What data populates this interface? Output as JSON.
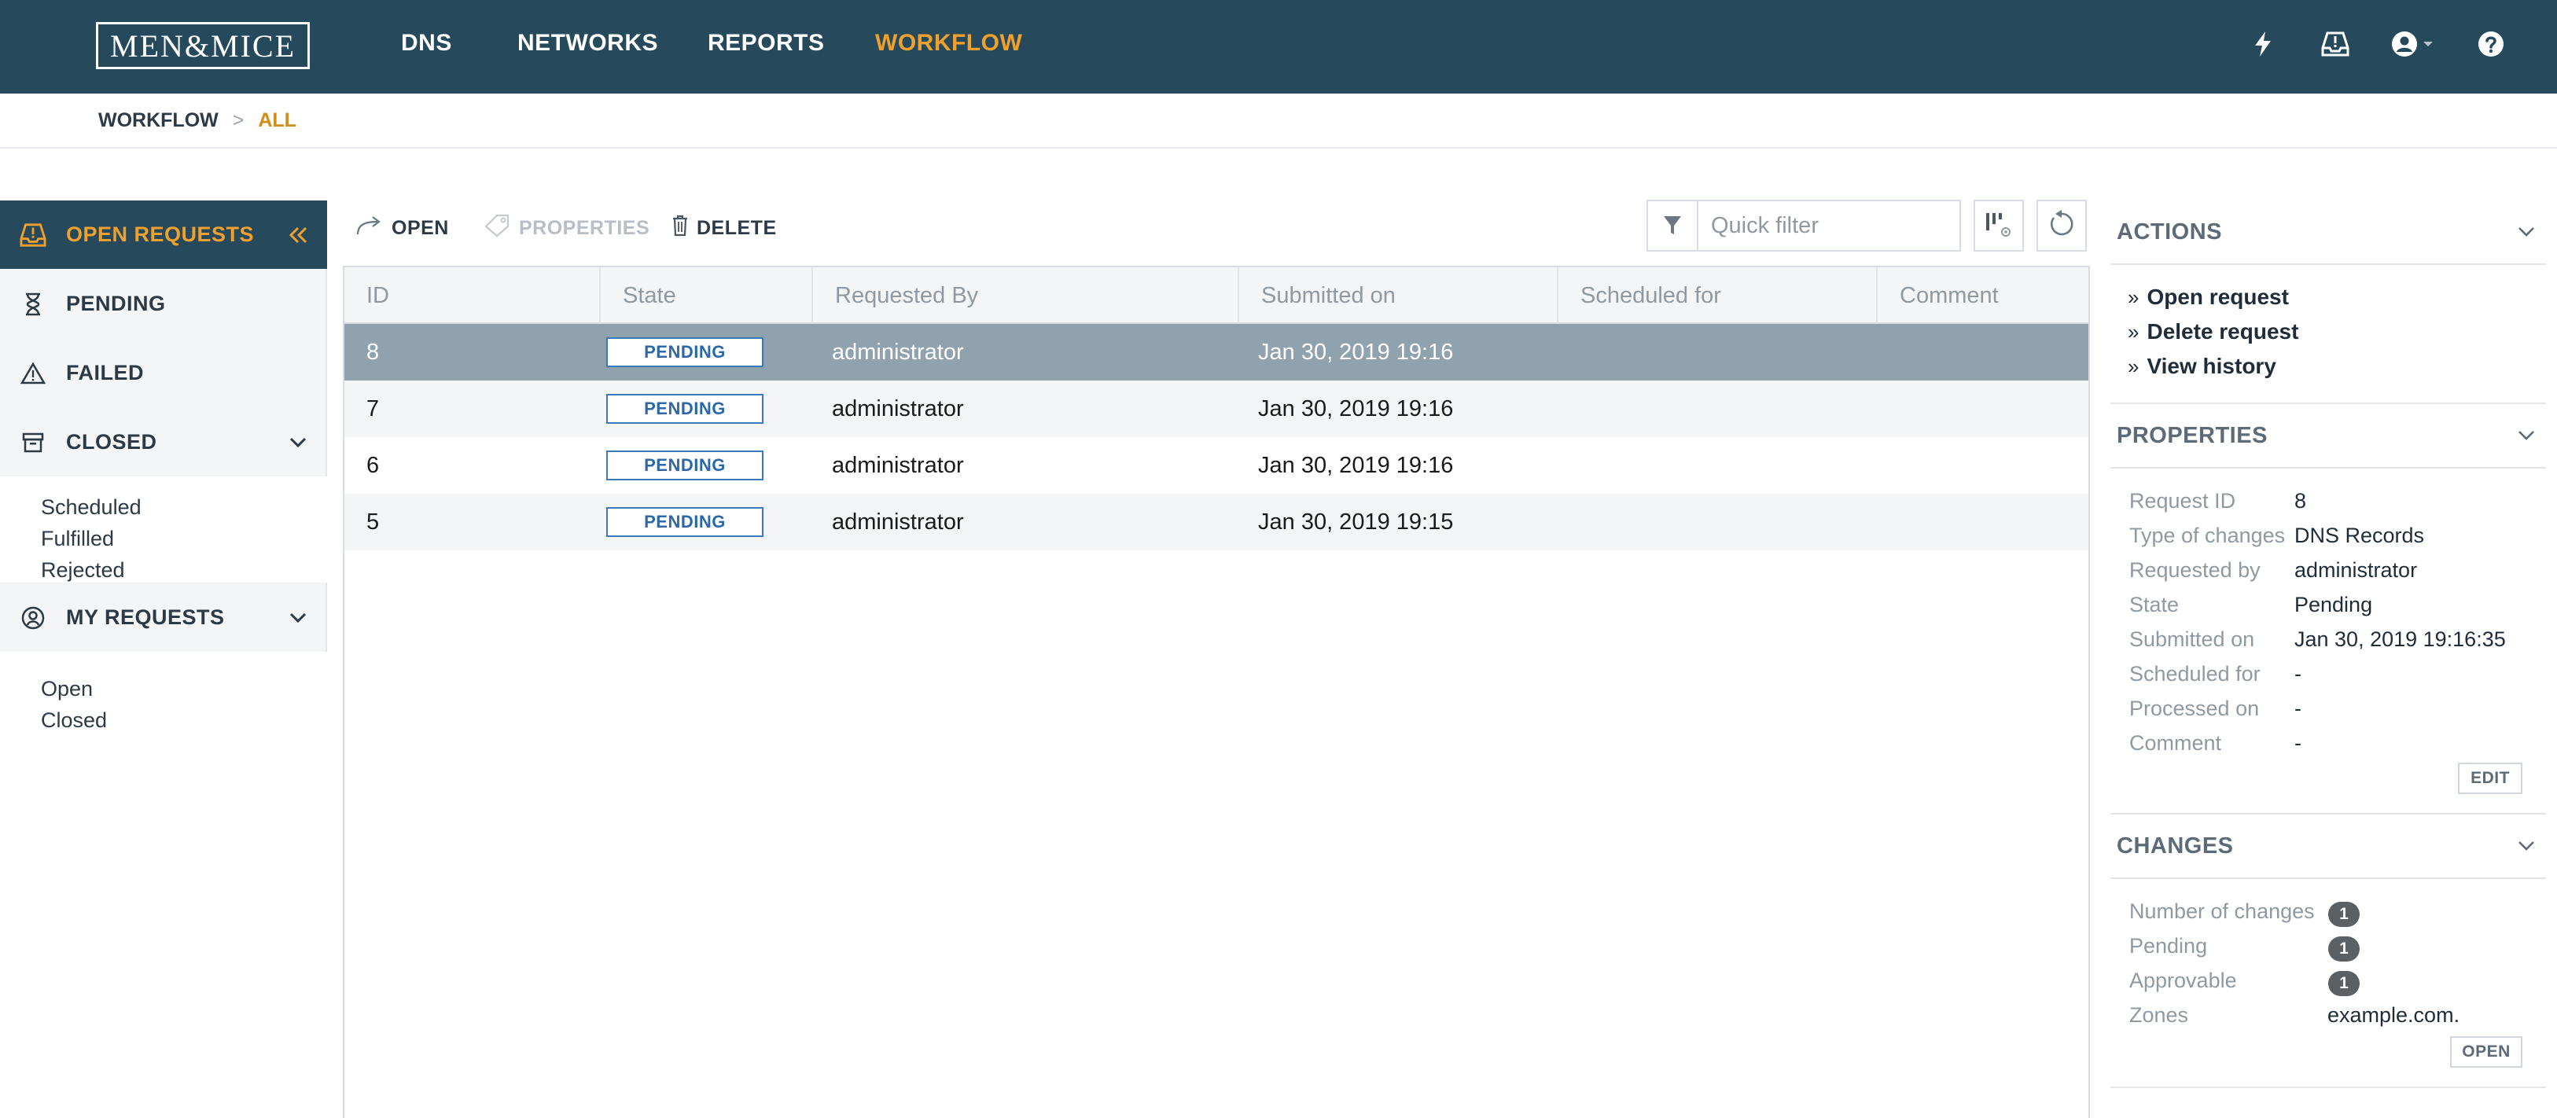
{
  "app": {
    "logo_text": "MEN&MICE"
  },
  "nav": {
    "items": [
      {
        "label": "DNS",
        "active": false
      },
      {
        "label": "NETWORKS",
        "active": false
      },
      {
        "label": "REPORTS",
        "active": false
      },
      {
        "label": "WORKFLOW",
        "active": true
      }
    ],
    "right_icons": [
      "lightning-icon",
      "inbox-alert-icon",
      "user-account-icon",
      "help-icon"
    ]
  },
  "breadcrumb": {
    "root": "WORKFLOW",
    "separator": ">",
    "current": "ALL"
  },
  "sidebar": {
    "open_requests": "OPEN REQUESTS",
    "pending": "PENDING",
    "failed": "FAILED",
    "closed": "CLOSED",
    "closed_items": [
      "Scheduled",
      "Fulfilled",
      "Rejected"
    ],
    "my_requests": "MY REQUESTS",
    "my_requests_items": [
      "Open",
      "Closed"
    ]
  },
  "toolbar": {
    "open": "OPEN",
    "properties": "PROPERTIES",
    "delete": "DELETE",
    "filter_placeholder": "Quick filter"
  },
  "table": {
    "columns": [
      "ID",
      "State",
      "Requested By",
      "Submitted on",
      "Scheduled for",
      "Comment"
    ],
    "rows": [
      {
        "id": "8",
        "state": "PENDING",
        "requested_by": "administrator",
        "submitted_on": "Jan 30, 2019 19:16",
        "scheduled_for": "",
        "comment": "",
        "selected": true
      },
      {
        "id": "7",
        "state": "PENDING",
        "requested_by": "administrator",
        "submitted_on": "Jan 30, 2019 19:16",
        "scheduled_for": "",
        "comment": "",
        "selected": false
      },
      {
        "id": "6",
        "state": "PENDING",
        "requested_by": "administrator",
        "submitted_on": "Jan 30, 2019 19:16",
        "scheduled_for": "",
        "comment": "",
        "selected": false
      },
      {
        "id": "5",
        "state": "PENDING",
        "requested_by": "administrator",
        "submitted_on": "Jan 30, 2019 19:15",
        "scheduled_for": "",
        "comment": "",
        "selected": false
      }
    ]
  },
  "actions": {
    "title": "ACTIONS",
    "items": [
      "Open request",
      "Delete request",
      "View history"
    ]
  },
  "properties": {
    "title": "PROPERTIES",
    "fields": [
      {
        "label": "Request ID",
        "value": "8"
      },
      {
        "label": "Type of changes",
        "value": "DNS Records"
      },
      {
        "label": "Requested by",
        "value": "administrator"
      },
      {
        "label": "State",
        "value": "Pending"
      },
      {
        "label": "Submitted on",
        "value": "Jan 30, 2019 19:16:35"
      },
      {
        "label": "Scheduled for",
        "value": "-"
      },
      {
        "label": "Processed on",
        "value": "-"
      },
      {
        "label": "Comment",
        "value": "-"
      }
    ],
    "edit_label": "EDIT"
  },
  "changes": {
    "title": "CHANGES",
    "number_of_changes_label": "Number of changes",
    "number_of_changes": "1",
    "pending_label": "Pending",
    "pending": "1",
    "approvable_label": "Approvable",
    "approvable": "1",
    "zones_label": "Zones",
    "zones": "example.com.",
    "open_label": "OPEN"
  },
  "colors": {
    "header_bg": "#264a5c",
    "accent": "#f0a02c",
    "selected_row": "#8fa2ad",
    "pill_border": "#3c78b4"
  }
}
